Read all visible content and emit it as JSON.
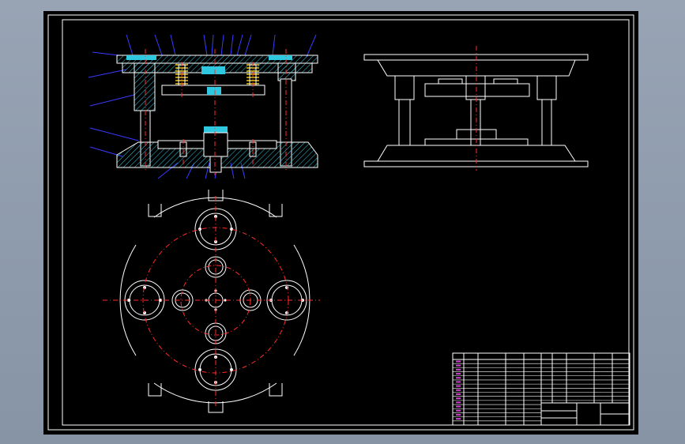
{
  "drawing": {
    "background": "#000000",
    "viewport_color": "#8e9aab",
    "line_color": "#ffffff",
    "centerline_color": "#ff2a2a",
    "hatch_color": "#2ec8e0",
    "spring_color": "#e8c020",
    "leader_color": "#3a3aff",
    "table_text_color": "#d040d0"
  },
  "views": {
    "front_section": {
      "title": "",
      "label": ""
    },
    "side_view": {
      "title": "",
      "label": ""
    },
    "plan_view": {
      "title": "",
      "label": ""
    }
  },
  "title_block": {
    "drawing_name": "",
    "header_cells": [
      "",
      "",
      "",
      "",
      "",
      ""
    ],
    "part_rows": 16
  }
}
